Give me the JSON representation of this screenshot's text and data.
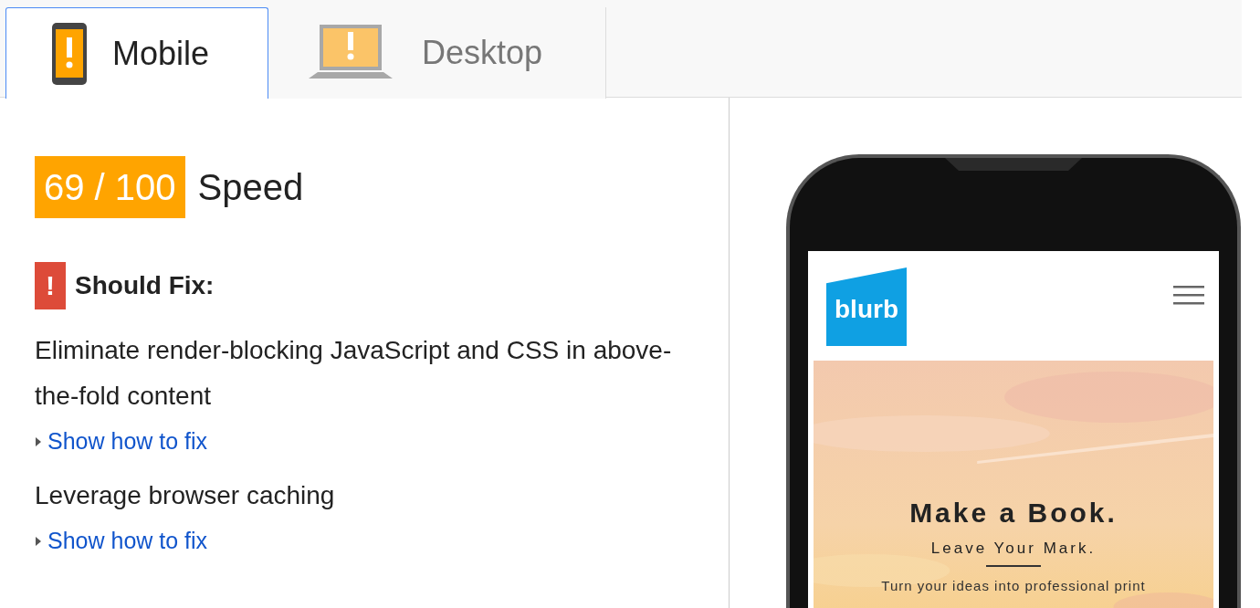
{
  "tabs": [
    {
      "label": "Mobile",
      "kind": "mobile",
      "selected": true
    },
    {
      "label": "Desktop",
      "kind": "desktop",
      "selected": false
    }
  ],
  "score": {
    "value": "69 / 100",
    "label": "Speed"
  },
  "section": {
    "icon": "!",
    "title": "Should Fix:"
  },
  "rules": [
    {
      "title": "Eliminate render-blocking JavaScript and CSS in above-the-fold content",
      "link": "Show how to fix",
      "expanded": false
    },
    {
      "title": "Leverage browser caching",
      "link": "Show how to fix",
      "expanded": false
    }
  ],
  "preview": {
    "logo": "blurb",
    "hero": {
      "kind": "picture",
      "title": "Make a Book.",
      "subtitle": "Leave Your Mark.",
      "text": "Turn your ideas into professional print"
    }
  }
}
